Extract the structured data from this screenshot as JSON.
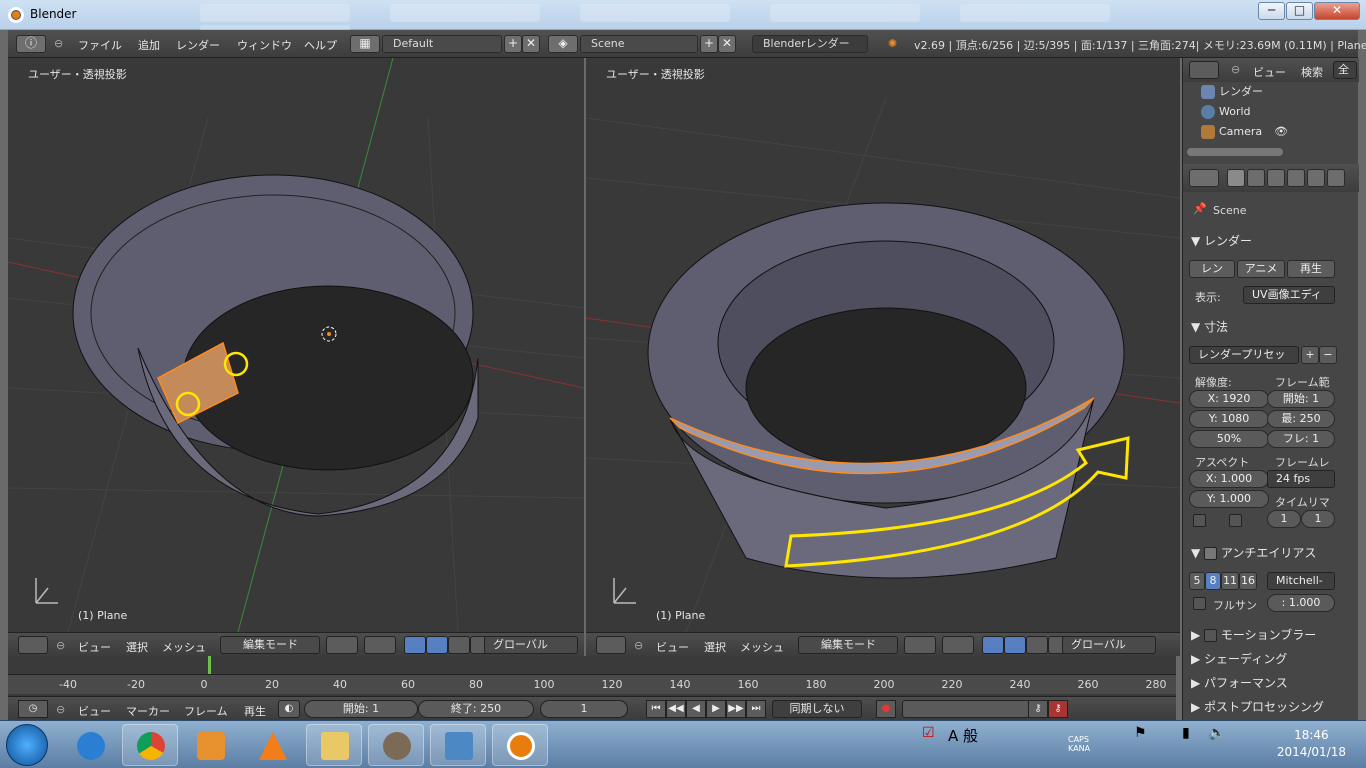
{
  "window": {
    "title": "Blender",
    "min": "─",
    "max": "□",
    "close": "✕"
  },
  "menubar": {
    "file": "ファイル",
    "add": "追加",
    "render": "レンダー",
    "window": "ウィンドウ",
    "help": "ヘルプ",
    "layout": "Default",
    "scene": "Scene",
    "engine": "Blenderレンダー",
    "stats": "v2.69 | 頂点:6/256 | 辺:5/395 | 面:1/137 | 三角面:274| メモリ:23.69M (0.11M) | Plane"
  },
  "viewport_left": {
    "label": "ユーザー・透視投影",
    "object": "(1) Plane"
  },
  "viewport_right": {
    "label": "ユーザー・透視投影",
    "object": "(1) Plane"
  },
  "view3d_header": {
    "view": "ビュー",
    "select": "選択",
    "mesh": "メッシュ",
    "mode": "編集モード",
    "orientation": "グローバル"
  },
  "timeline": {
    "ticks": [
      "-40",
      "-20",
      "0",
      "20",
      "40",
      "60",
      "80",
      "100",
      "120",
      "140",
      "160",
      "180",
      "200",
      "220",
      "240",
      "260",
      "280"
    ],
    "current_frame_marker": "0"
  },
  "timeline_header": {
    "view": "ビュー",
    "marker": "マーカー",
    "frame": "フレーム",
    "playback": "再生",
    "start": "開始: 1",
    "end": "終了: 250",
    "current": "1",
    "sync": "同期しない"
  },
  "outliner": {
    "view": "ビュー",
    "search": "検索",
    "all": "全て",
    "items": [
      "レンダー",
      "World",
      "Camera"
    ]
  },
  "properties": {
    "scene": "Scene",
    "render_section": "レンダー",
    "render_btn": "レン",
    "anim_btn": "アニメ",
    "play_btn": "再生",
    "display_label": "表示:",
    "display_value": "UV画像エディ",
    "dimensions_section": "寸法",
    "preset": "レンダープリセッ",
    "resolution_label": "解像度:",
    "frame_range_label": "フレーム範",
    "res_x": "X: 1920",
    "res_y": "Y: 1080",
    "res_pct": "50%",
    "frame_start": "開始: 1",
    "frame_end": "最: 250",
    "frame_step": "フレ: 1",
    "aspect_label": "アスペクト",
    "framerate_label": "フレームレ",
    "aspect_x": "X: 1.000",
    "aspect_y": "Y: 1.000",
    "fps": "24 fps",
    "time_remap_label": "タイムリマ",
    "remap_old": "1",
    "remap_new": "1",
    "aa_section": "アンチエイリアス",
    "aa_samples": [
      "5",
      "8",
      "11",
      "16"
    ],
    "aa_filter": "Mitchell-",
    "full_sample": "フルサン",
    "filter_size": ": 1.000",
    "motion_blur": "モーションブラー",
    "shading": "シェーディング",
    "performance": "パフォーマンス",
    "post_processing": "ポストプロセッシング"
  },
  "taskbar": {
    "time": "18:46",
    "date": "2014/01/18",
    "ime": "A 般",
    "caps": "CAPS",
    "kana": "KANA"
  },
  "colors": {
    "selection": "#ff8c1a",
    "annotation": "#ffe600",
    "mesh_face": "#8f8fa6",
    "mesh_dark": "#5a5a6a",
    "accent": "#5680c2"
  }
}
